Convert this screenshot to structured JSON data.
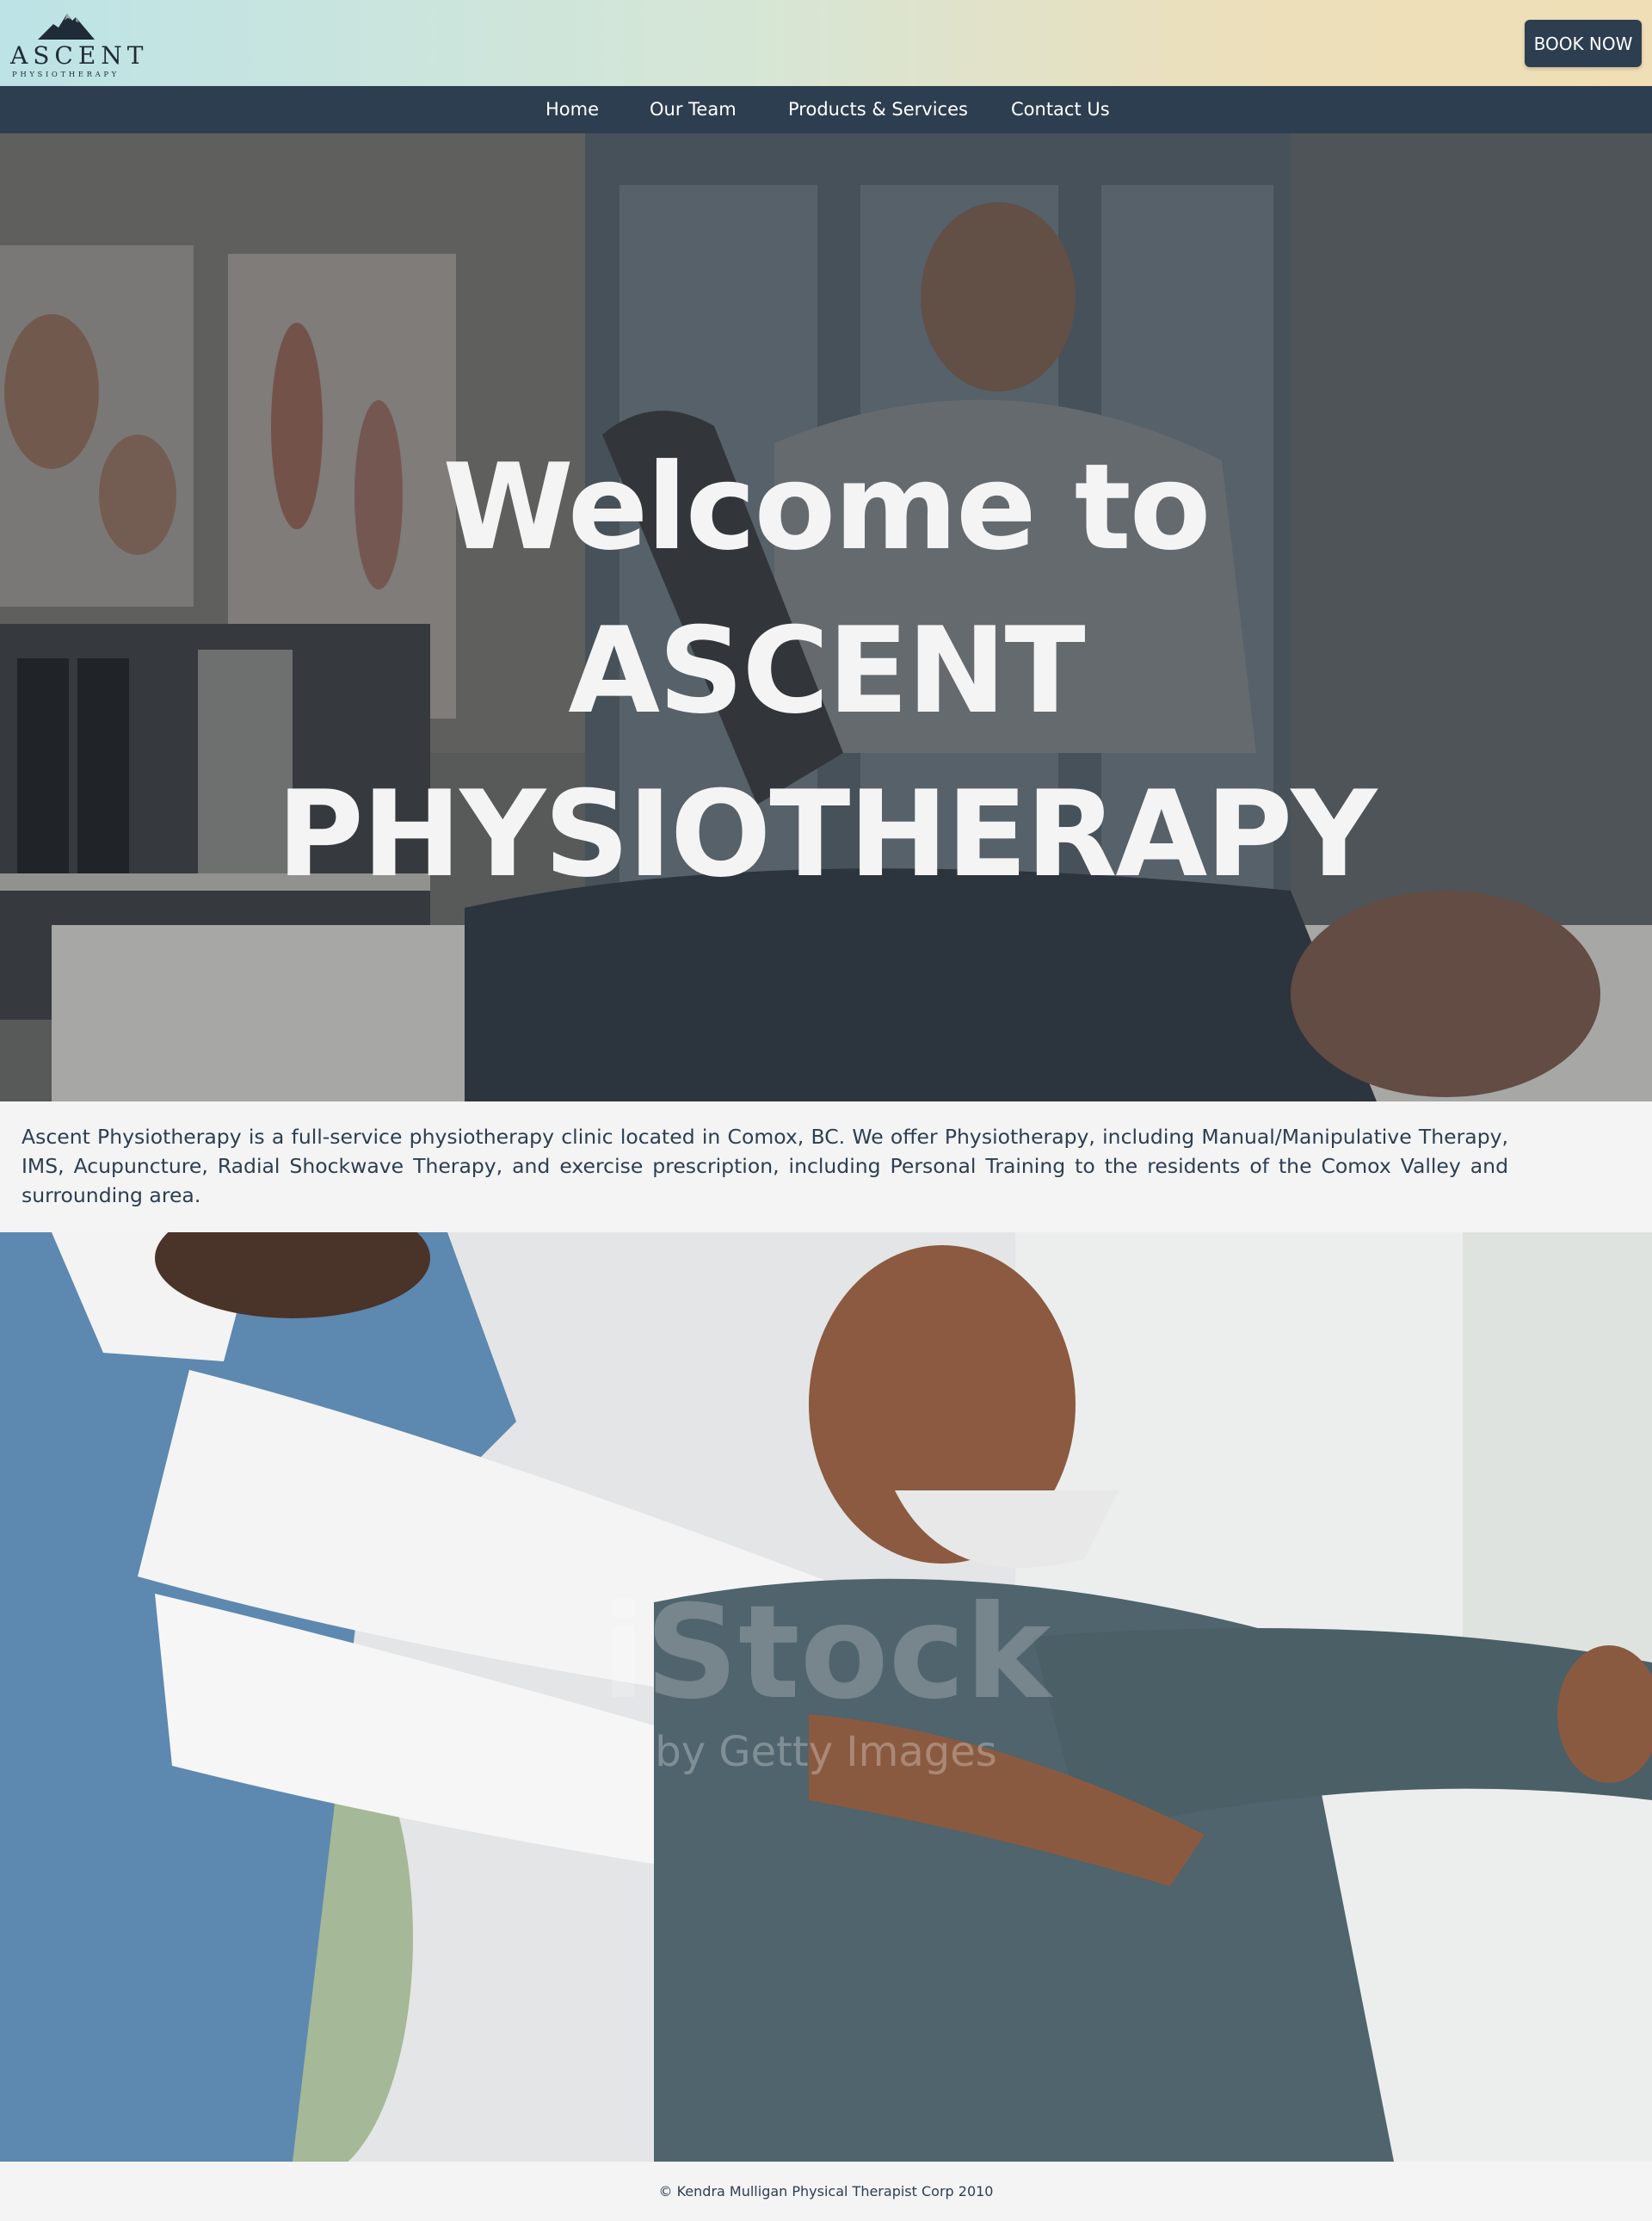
{
  "header": {
    "logo_name": "ASCENT",
    "logo_subtitle": "PHYSIOTHERAPY",
    "book_button_label": "BOOK NOW"
  },
  "nav": {
    "items": [
      {
        "label": "Home"
      },
      {
        "label": "Our Team"
      },
      {
        "label": "Products & Services"
      },
      {
        "label": "Contact Us"
      }
    ]
  },
  "hero": {
    "title_lines": [
      "Welcome to",
      "ASCENT",
      "PHYSIOTHERAPY"
    ]
  },
  "intro": {
    "text": "Ascent Physiotherapy is a full-service physiotherapy clinic located in Comox, BC. We offer Physiotherapy, including Manual/Manipulative Therapy, IMS, Acupuncture, Radial Shockwave Therapy, and exercise prescription, including Personal Training to the residents of the Comox Valley and surrounding area."
  },
  "gallery": {
    "watermark_main": "iStock",
    "watermark_sub": "by Getty Images"
  },
  "footer": {
    "copyright": "© Kendra Mulligan Physical Therapist Corp 2010"
  },
  "colors": {
    "navy": "#2d3e50",
    "page_bg": "#f4f4f4",
    "header_gradient_start": "#bde3e6",
    "header_gradient_end": "#f0dfb6",
    "hero_text": "#f4f4f4"
  }
}
